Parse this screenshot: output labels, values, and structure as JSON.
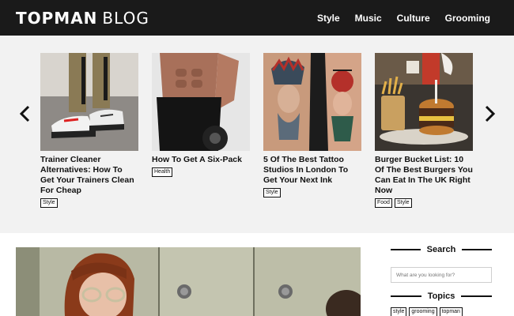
{
  "header": {
    "logo_bold": "TOPMAN",
    "logo_light": "BLOG",
    "nav": [
      "Style",
      "Music",
      "Culture",
      "Grooming"
    ]
  },
  "carousel": {
    "prev_icon": "chevron-left-icon",
    "next_icon": "chevron-right-icon",
    "cards": [
      {
        "title": "Trainer Cleaner Alternatives: How To Get Your Trainers Clean For Cheap",
        "tags": [
          "Style"
        ]
      },
      {
        "title": "How To Get A Six-Pack",
        "tags": [
          "Health"
        ]
      },
      {
        "title": "5 Of The Best Tattoo Studios In London To Get Your Next Ink",
        "tags": [
          "Style"
        ]
      },
      {
        "title": "Burger Bucket List: 10 Of The Best Burgers You Can Eat In The UK Right Now",
        "tags": [
          "Food",
          "Style"
        ]
      }
    ]
  },
  "sidebar": {
    "search_heading": "Search",
    "search_placeholder": "What are you looking for?",
    "topics_heading": "Topics",
    "topics": [
      "style",
      "grooming",
      "topman"
    ]
  },
  "colors": {
    "header_bg": "#1a1a1a",
    "carousel_bg": "#f2f2f2",
    "text": "#111111"
  }
}
